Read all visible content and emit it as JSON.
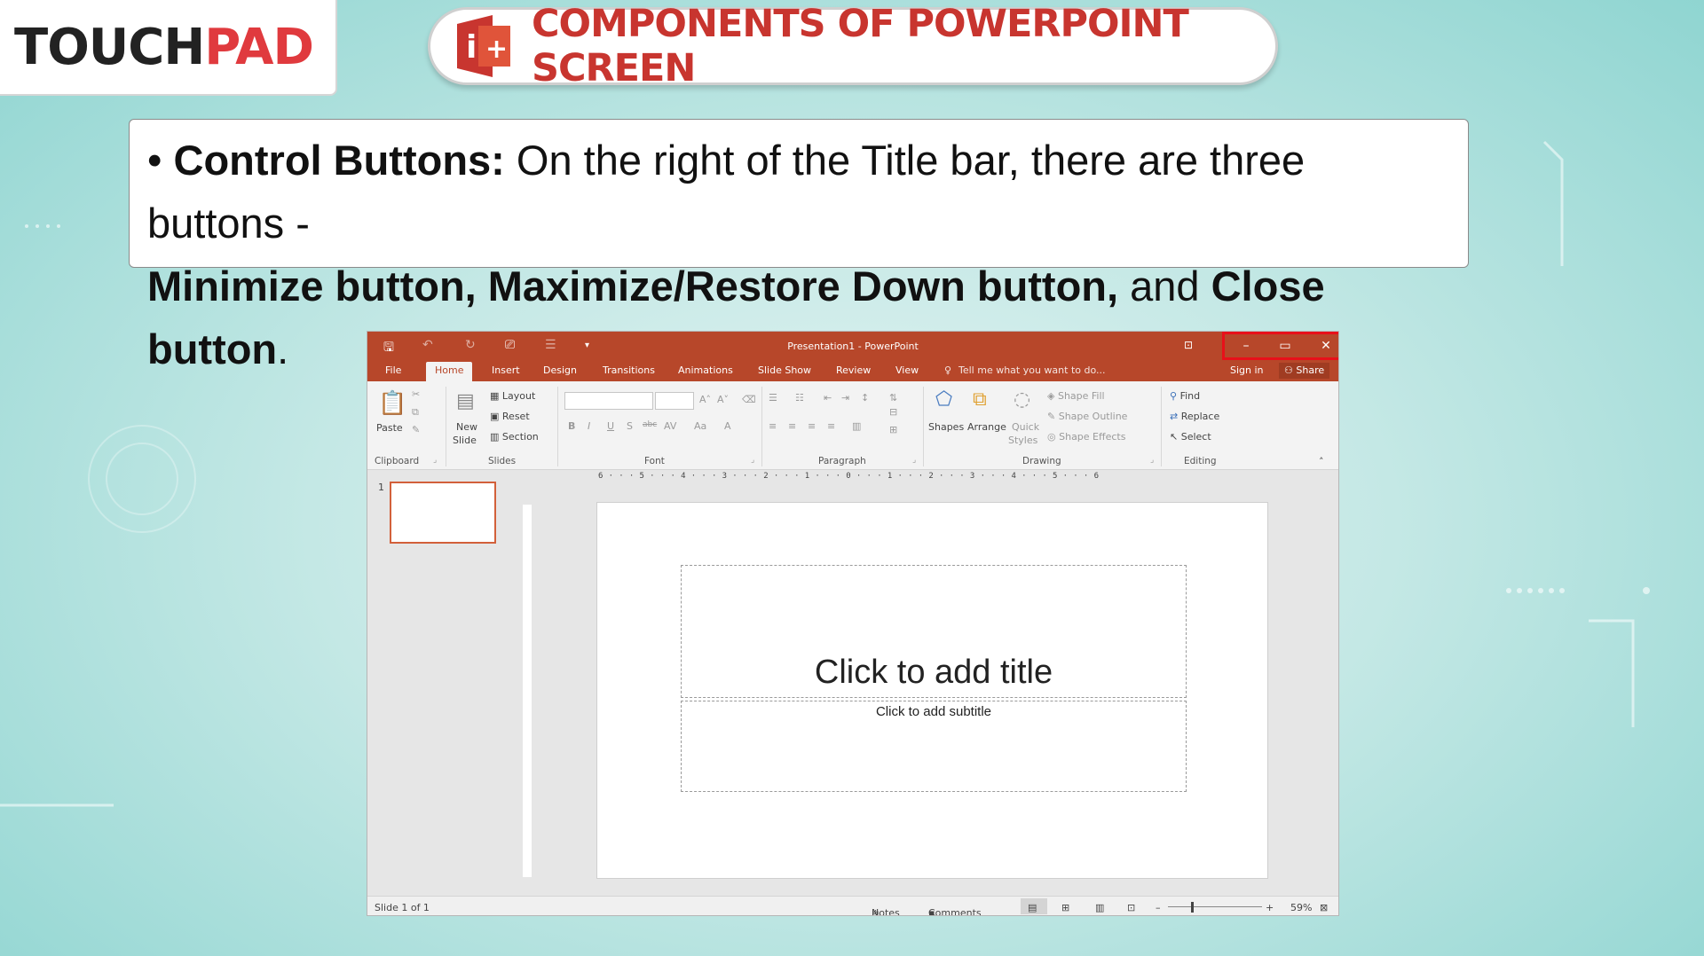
{
  "logo": {
    "part1": "TOUCH",
    "part2": "PAD"
  },
  "header": {
    "title": "COMPONENTS OF POWERPOINT SCREEN"
  },
  "description": {
    "bullet": "•",
    "label": "Control Buttons:",
    "text1": " On the right of the Title bar, there are three buttons -",
    "bold2": "Minimize button, Maximize/Restore Down button,",
    "text2": " and ",
    "bold3": "Close button",
    "text3": "."
  },
  "window": {
    "title": "Presentation1 - PowerPoint",
    "controls": {
      "minimize": "–",
      "maximize": "▭",
      "close": "✕"
    },
    "tabs": [
      "File",
      "Home",
      "Insert",
      "Design",
      "Transitions",
      "Animations",
      "Slide Show",
      "Review",
      "View"
    ],
    "active_tab": "Home",
    "tell_me": "Tell me what you want to do...",
    "sign_in": "Sign in",
    "share": "Share",
    "ribbon": {
      "clipboard": {
        "paste": "Paste",
        "label": "Clipboard"
      },
      "slides": {
        "new_slide_1": "New",
        "new_slide_2": "Slide",
        "layout": "Layout",
        "reset": "Reset",
        "section": "Section",
        "label": "Slides"
      },
      "font": {
        "label": "Font",
        "bold": "B",
        "italic": "I",
        "underline": "U",
        "shadow": "S",
        "strike": "abc",
        "spacing": "AV",
        "case": "Aa",
        "color": "A"
      },
      "paragraph": {
        "label": "Paragraph"
      },
      "drawing": {
        "shapes": "Shapes",
        "arrange": "Arrange",
        "quick_1": "Quick",
        "quick_2": "Styles",
        "shape_fill": "Shape Fill",
        "shape_outline": "Shape Outline",
        "shape_effects": "Shape Effects",
        "label": "Drawing"
      },
      "editing": {
        "find": "Find",
        "replace": "Replace",
        "select": "Select",
        "label": "Editing"
      }
    },
    "ruler_h": "6 · · · 5 · · · 4 · · · 3 · · · 2 · · · 1 · · · 0 · · · 1 · · · 2 · · · 3 · · · 4 · · · 5 · · · 6",
    "thumb_number": "1",
    "slide": {
      "title_placeholder": "Click to add title",
      "subtitle_placeholder": "Click to add subtitle"
    },
    "status": {
      "slide_info": "Slide 1 of 1",
      "notes": "Notes",
      "comments": "Comments",
      "zoom": "59%"
    }
  }
}
